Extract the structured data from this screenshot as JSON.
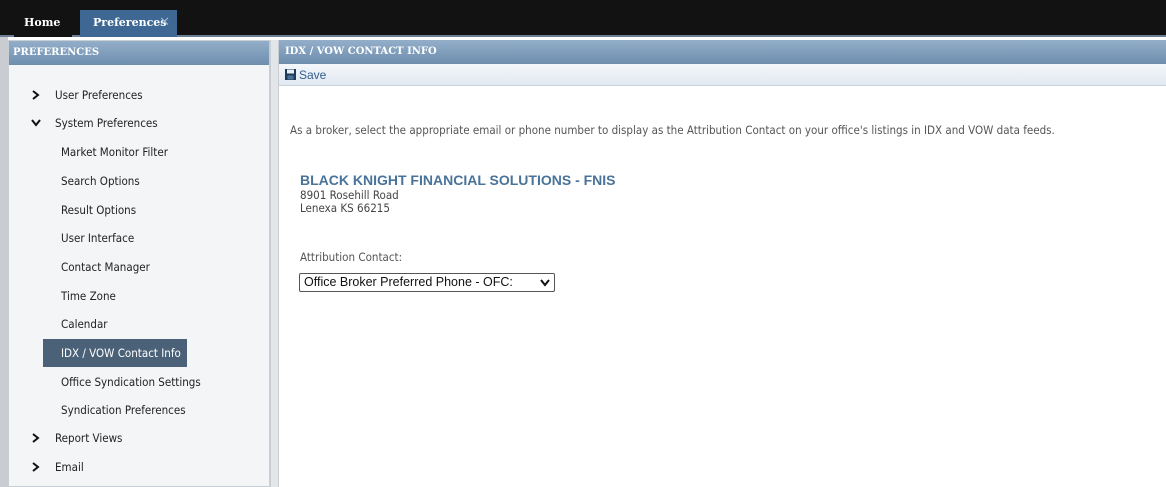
{
  "tabs": [
    {
      "label": "Home"
    },
    {
      "label": "Preferences",
      "close": "✕"
    }
  ],
  "sidebar": {
    "title": "PREFERENCES",
    "items": [
      {
        "label": "User Preferences",
        "expanded": false
      },
      {
        "label": "System Preferences",
        "expanded": true
      },
      {
        "label": "Report Views",
        "expanded": false
      },
      {
        "label": "Email",
        "expanded": false
      }
    ],
    "system_children": [
      "Market Monitor Filter",
      "Search Options",
      "Result Options",
      "User Interface",
      "Contact Manager",
      "Time Zone",
      "Calendar",
      "IDX / VOW Contact Info",
      "Office Syndication Settings",
      "Syndication Preferences"
    ],
    "active_item": "IDX / VOW Contact Info"
  },
  "main": {
    "title": "IDX / VOW CONTACT INFO",
    "toolbar": {
      "save_label": "Save"
    },
    "intro": "As a broker, select the appropriate email or phone number to display as the Attribution Contact on your office's listings in IDX and VOW data feeds.",
    "office": {
      "name": "BLACK KNIGHT FINANCIAL SOLUTIONS - FNIS",
      "address1": "8901 Rosehill Road",
      "address2": "Lenexa KS 66215"
    },
    "attribution": {
      "label": "Attribution Contact:",
      "selected": "Office Broker Preferred Phone - OFC:"
    }
  },
  "colors": {
    "tab_active": "#3e6893",
    "header_gradient_top": "#93aec9",
    "header_gradient_bottom": "#6e8eae",
    "active_nav": "#4a6178",
    "office_name": "#4a7399"
  }
}
